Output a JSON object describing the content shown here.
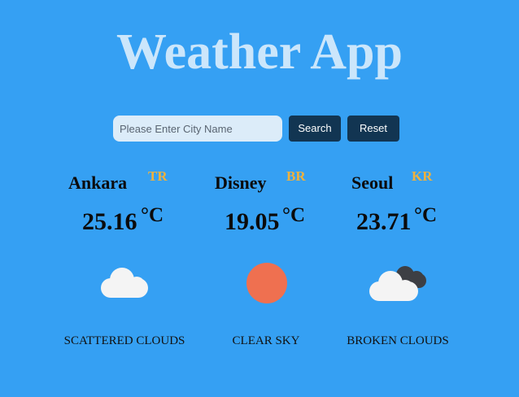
{
  "app": {
    "title": "Weather App"
  },
  "search": {
    "placeholder": "Please Enter City Name",
    "value": "",
    "search_label": "Search",
    "reset_label": "Reset"
  },
  "cities": [
    {
      "name": "Ankara",
      "country": "TR",
      "temp": "25.16",
      "unit": "°C",
      "description": "SCATTERED CLOUDS",
      "icon": "scattered-clouds-icon"
    },
    {
      "name": "Disney",
      "country": "BR",
      "temp": "19.05",
      "unit": "°C",
      "description": "CLEAR SKY",
      "icon": "clear-sky-icon"
    },
    {
      "name": "Seoul",
      "country": "KR",
      "temp": "23.71",
      "unit": "°C",
      "description": "BROKEN CLOUDS",
      "icon": "broken-clouds-icon"
    }
  ],
  "colors": {
    "background": "#35a0f3",
    "title": "#cbe6fb",
    "button": "#123552",
    "country_code": "#f0b13c",
    "sun": "#ef7050"
  }
}
